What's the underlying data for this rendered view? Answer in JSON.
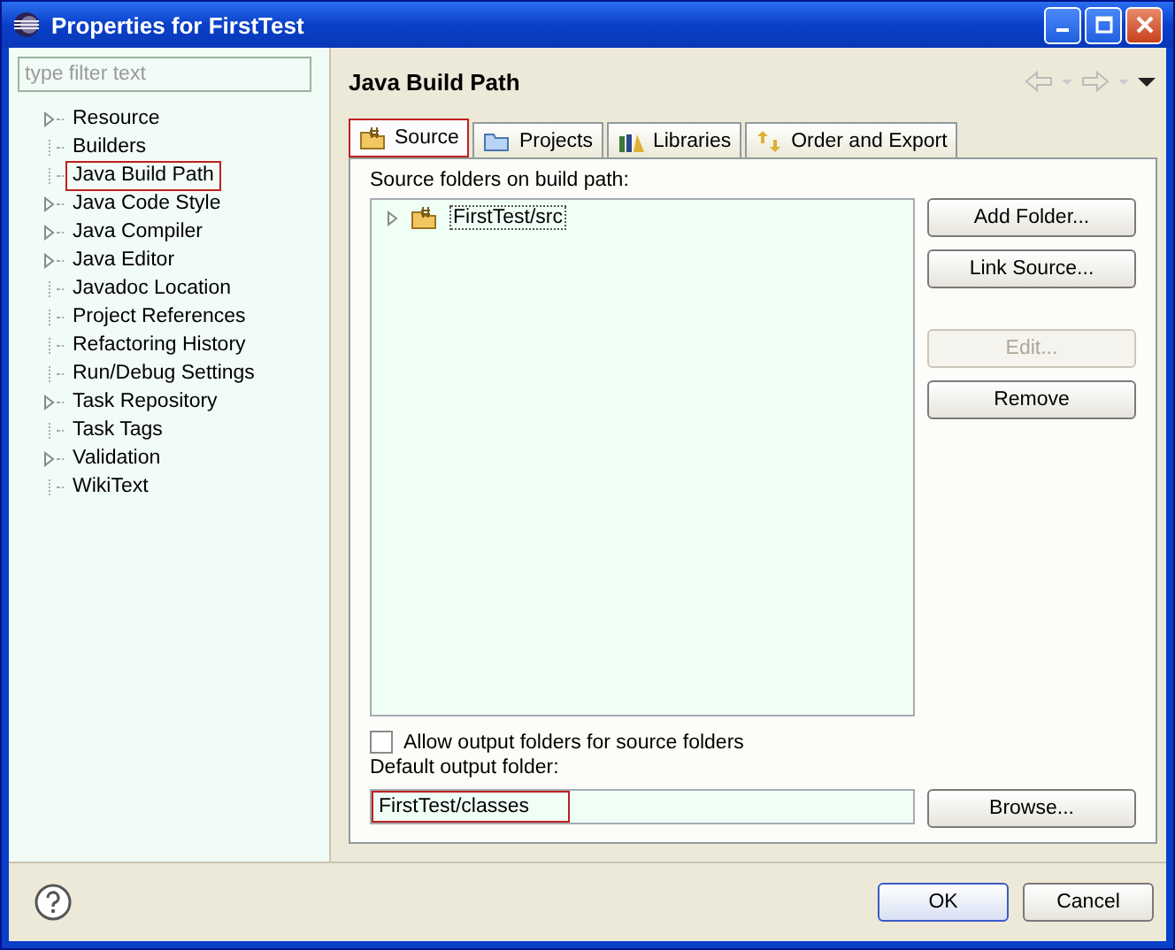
{
  "window": {
    "title": "Properties for FirstTest"
  },
  "filter": {
    "placeholder": "type filter text"
  },
  "sidebar": {
    "items": [
      {
        "label": "Resource",
        "expandable": true,
        "selected": false
      },
      {
        "label": "Builders",
        "expandable": false,
        "selected": false
      },
      {
        "label": "Java Build Path",
        "expandable": false,
        "selected": true
      },
      {
        "label": "Java Code Style",
        "expandable": true,
        "selected": false
      },
      {
        "label": "Java Compiler",
        "expandable": true,
        "selected": false
      },
      {
        "label": "Java Editor",
        "expandable": true,
        "selected": false
      },
      {
        "label": "Javadoc Location",
        "expandable": false,
        "selected": false
      },
      {
        "label": "Project References",
        "expandable": false,
        "selected": false
      },
      {
        "label": "Refactoring History",
        "expandable": false,
        "selected": false
      },
      {
        "label": "Run/Debug Settings",
        "expandable": false,
        "selected": false
      },
      {
        "label": "Task Repository",
        "expandable": true,
        "selected": false
      },
      {
        "label": "Task Tags",
        "expandable": false,
        "selected": false
      },
      {
        "label": "Validation",
        "expandable": true,
        "selected": false
      },
      {
        "label": "WikiText",
        "expandable": false,
        "selected": false
      }
    ]
  },
  "page": {
    "title": "Java Build Path"
  },
  "tabs": [
    {
      "label": "Source",
      "kind": "source",
      "selected": true
    },
    {
      "label": "Projects",
      "kind": "projects",
      "selected": false
    },
    {
      "label": "Libraries",
      "kind": "libraries",
      "selected": false
    },
    {
      "label": "Order and Export",
      "kind": "order",
      "selected": false
    }
  ],
  "source_label": "Source folders on build path:",
  "source_folders": [
    {
      "label": "FirstTest/src",
      "expanded": false
    }
  ],
  "side_buttons": [
    {
      "label": "Add Folder...",
      "disabled": false
    },
    {
      "label": "Link Source...",
      "disabled": false
    },
    {
      "label": "Edit...",
      "disabled": true
    },
    {
      "label": "Remove",
      "disabled": false
    }
  ],
  "allow_output": {
    "label": "Allow output folders for source folders",
    "checked": false
  },
  "output": {
    "label": "Default output folder:",
    "value": "FirstTest/classes",
    "browse": "Browse..."
  },
  "buttons": [
    "OK",
    "Cancel"
  ]
}
